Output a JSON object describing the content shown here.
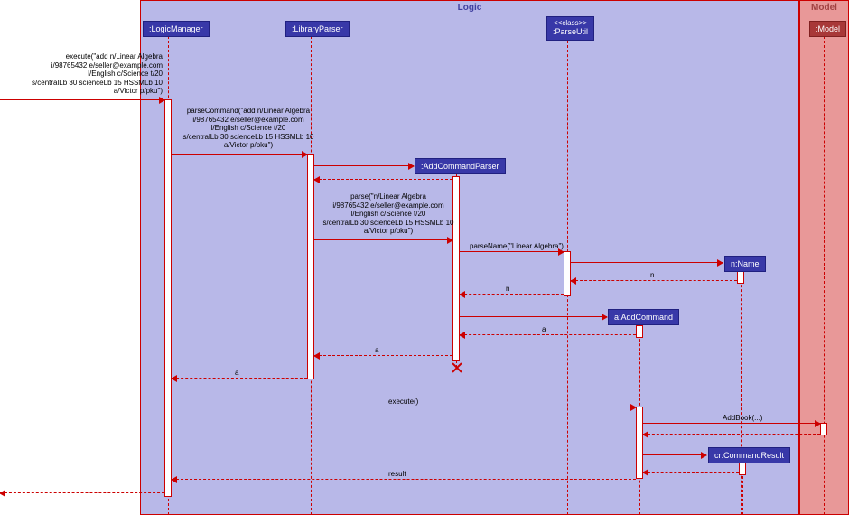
{
  "frames": {
    "logic": "Logic",
    "model": "Model"
  },
  "participants": {
    "logicManager": ":LogicManager",
    "libraryParser": ":LibraryParser",
    "parseUtilStereo": "<<class>>",
    "parseUtil": ":ParseUtil",
    "addCommandParser": ":AddCommandParser",
    "name": "n:Name",
    "addCommand": "a:AddCommand",
    "commandResult": "cr:CommandResult",
    "model": ":Model"
  },
  "messages": {
    "execute": "execute(\"add n/Linear Algebra\ni/98765432 e/seller@example.com\nl/English c/Science t/20\ns/centralLb 30 scienceLb 15 HSSMLb 10\na/Victor p/pku\")",
    "parseCommand": "parseCommand(\"add n/Linear Algebra\ni/98765432 e/seller@example.com\nl/English c/Science t/20\ns/centralLb 30 scienceLb 15 HSSMLb 10\na/Victor p/pku\")",
    "parse": "parse(\"n/Linear Algebra\ni/98765432 e/seller@example.com\nl/English c/Science t/20\ns/centralLb 30 scienceLb 15 HSSMLb 10\na/Victor p/pku\")",
    "parseName": "parseName(\"Linear Algebra\")",
    "n": "n",
    "a": "a",
    "executeCall": "execute()",
    "addBook": "AddBook(...)",
    "result": "result"
  }
}
